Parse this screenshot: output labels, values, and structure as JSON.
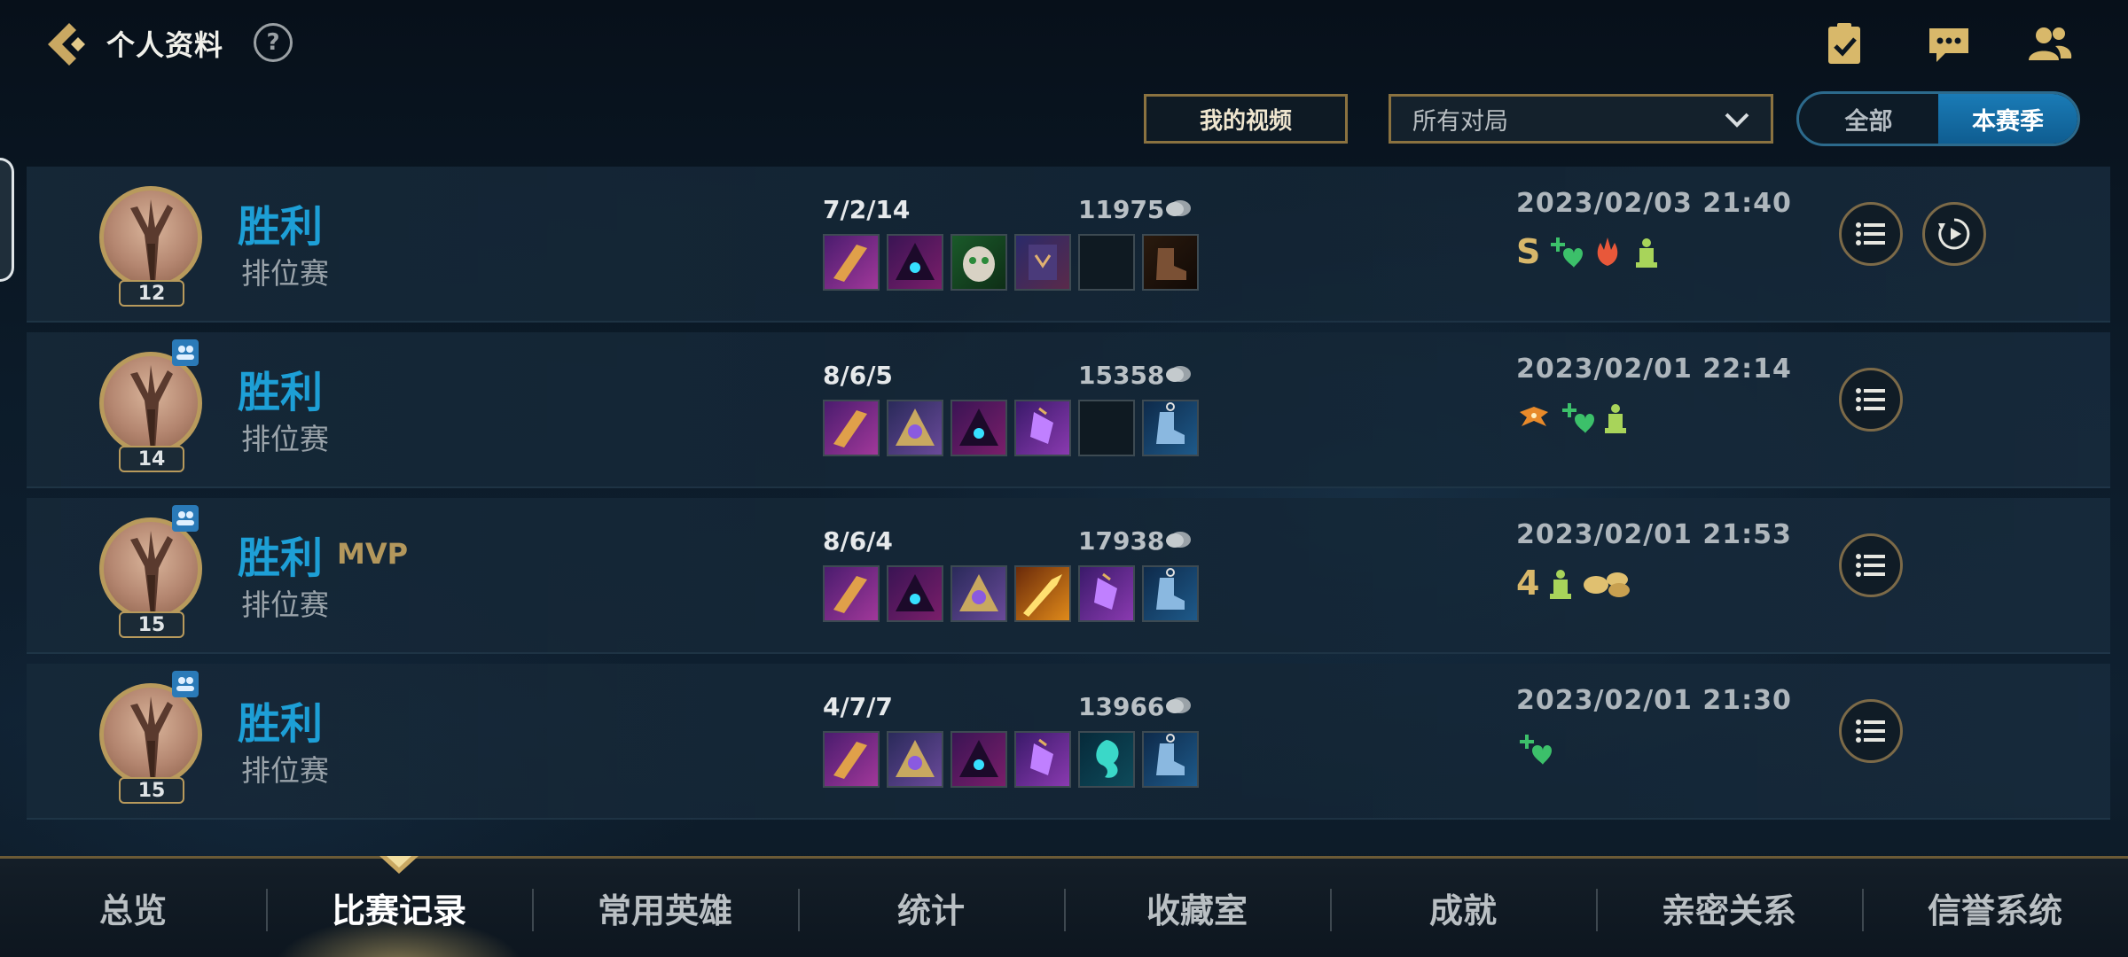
{
  "header": {
    "title": "个人资料",
    "help": "?"
  },
  "filters": {
    "my_video": "我的视频",
    "match_filter": "所有对局",
    "season_options": [
      "全部",
      "本赛季"
    ],
    "season_selected": "本赛季"
  },
  "matches": [
    {
      "result": "胜利",
      "mvp": "",
      "queue": "排位赛",
      "level": "12",
      "party": false,
      "kda": "7/2/14",
      "gold": "11975",
      "datetime": "2023/02/03 21:40",
      "badges": [
        "S",
        "heal-icon",
        "flame-icon",
        "tower-icon"
      ],
      "has_replay": true
    },
    {
      "result": "胜利",
      "mvp": "",
      "queue": "排位赛",
      "level": "14",
      "party": true,
      "kda": "8/6/5",
      "gold": "15358",
      "datetime": "2023/02/01 22:14",
      "badges": [
        "dragon-icon",
        "heal-icon",
        "tower-icon"
      ],
      "has_replay": false
    },
    {
      "result": "胜利",
      "mvp": "MVP",
      "queue": "排位赛",
      "level": "15",
      "party": true,
      "kda": "8/6/4",
      "gold": "17938",
      "datetime": "2023/02/01 21:53",
      "badges": [
        "4",
        "tower-icon",
        "coins-icon"
      ],
      "has_replay": false
    },
    {
      "result": "胜利",
      "mvp": "",
      "queue": "排位赛",
      "level": "15",
      "party": true,
      "kda": "4/7/7",
      "gold": "13966",
      "datetime": "2023/02/01 21:30",
      "badges": [
        "heal-icon"
      ],
      "has_replay": false
    }
  ],
  "tabs": [
    "总览",
    "比赛记录",
    "常用英雄",
    "统计",
    "收藏室",
    "成就",
    "亲密关系",
    "信誉系统"
  ],
  "active_tab": "比赛记录",
  "colors": {
    "victory": "#1d9fd6",
    "gold_accent": "#b89a5c",
    "toggle_active": "#1a7bb6"
  }
}
